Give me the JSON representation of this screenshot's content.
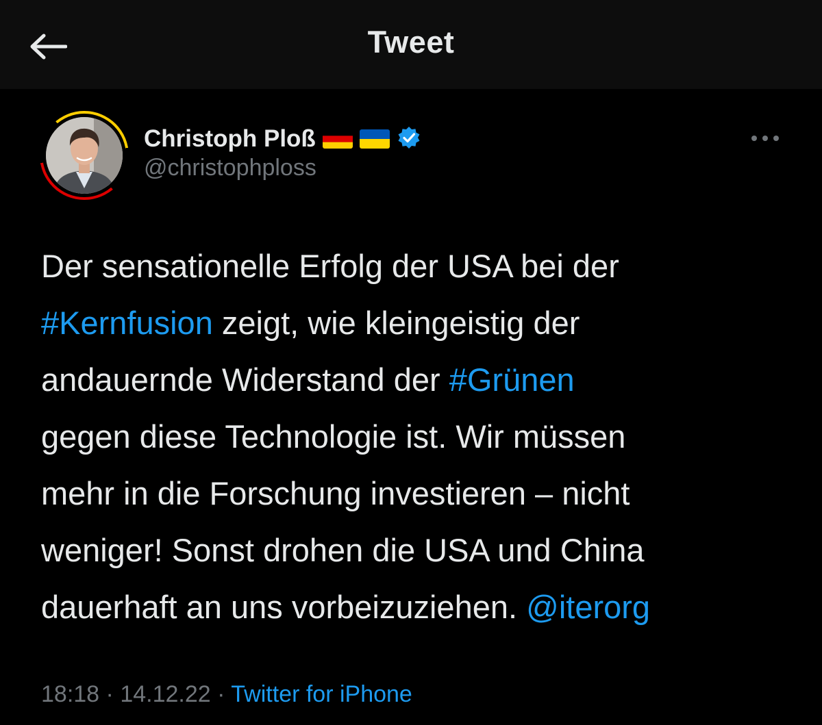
{
  "header": {
    "title": "Tweet",
    "back_icon": "arrow-left-icon"
  },
  "author": {
    "display_name": "Christoph Ploß",
    "handle": "@christophploss",
    "flags": [
      "germany-flag-icon",
      "ukraine-flag-icon"
    ],
    "verified_icon": "verified-badge-icon",
    "more_icon": "more-horizontal-icon"
  },
  "tweet": {
    "lines": [
      [
        {
          "text": "Der sensationelle Erfolg der USA bei der",
          "link": false
        }
      ],
      [
        {
          "text": "#Kernfusion",
          "link": true
        },
        {
          "text": " zeigt, wie kleingeistig der",
          "link": false
        }
      ],
      [
        {
          "text": "andauernde Widerstand der ",
          "link": false
        },
        {
          "text": "#Grünen",
          "link": true
        }
      ],
      [
        {
          "text": "gegen diese Technologie ist. Wir müssen",
          "link": false
        }
      ],
      [
        {
          "text": "mehr in die Forschung investieren – nicht",
          "link": false
        }
      ],
      [
        {
          "text": "weniger! Sonst drohen die USA und China",
          "link": false
        }
      ],
      [
        {
          "text": "dauerhaft an uns vorbeizuziehen. ",
          "link": false
        },
        {
          "text": "@iterorg",
          "link": true
        }
      ]
    ]
  },
  "meta": {
    "time": "18:18",
    "separator": " · ",
    "date": "14.12.22",
    "source": "Twitter for iPhone"
  },
  "colors": {
    "background": "#000000",
    "header_background": "#0d0d0d",
    "text": "#e7e9ea",
    "secondary_text": "#71767b",
    "link": "#1d9bf0",
    "verified": "#1d9bf0"
  }
}
